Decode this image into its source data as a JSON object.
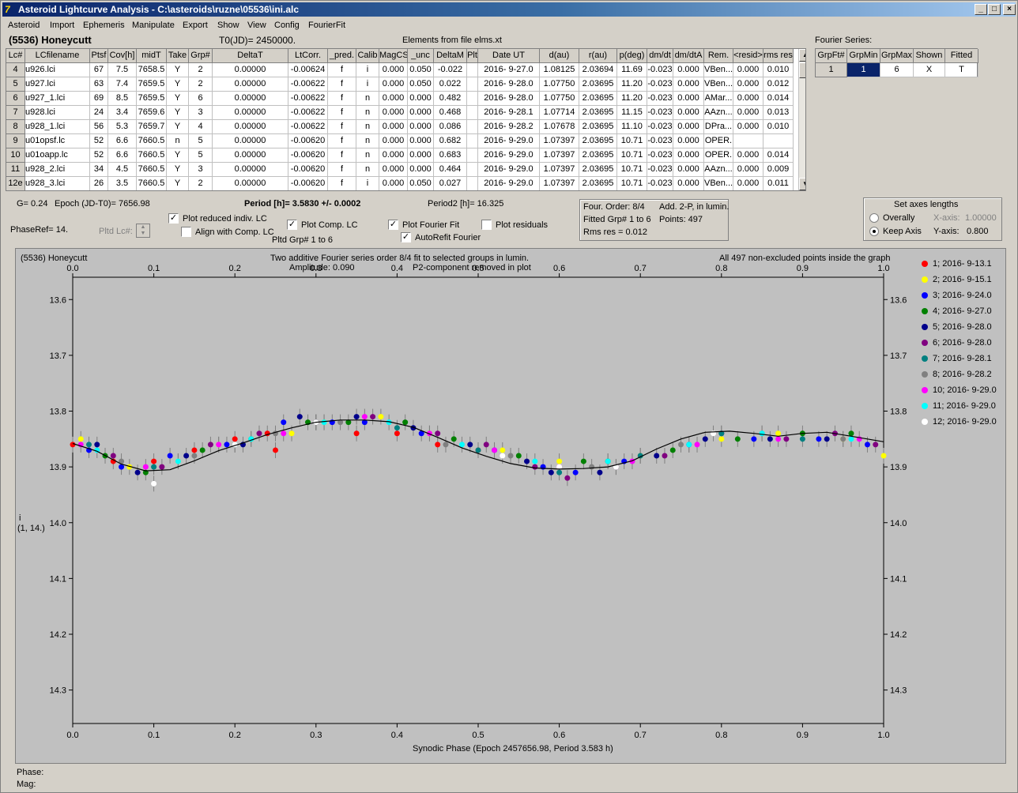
{
  "window": {
    "title": "Asteroid Lightcurve Analysis - C:\\asteroids\\ruzne\\05536\\ini.alc",
    "controls": [
      "_",
      "□",
      "×"
    ]
  },
  "menu": [
    "Asteroid",
    "Import",
    "Ephemeris",
    "Manipulate",
    "Export",
    "Show",
    "View",
    "Config",
    "FourierFit"
  ],
  "header": {
    "asteroid": "(5536) Honeycutt",
    "t0": "T0(JD)= 2450000.",
    "elements": "Elements from file elms.xt",
    "fourier_series_label": "Fourier Series:"
  },
  "lc_table": {
    "columns": [
      "Lc#",
      "LCfilename",
      "Ptsf",
      "Cov[h]",
      "midT",
      "Take",
      "Grp#",
      "DeltaT",
      "LtCorr.",
      "_pred.",
      "Calib",
      "MagCS",
      "_unc",
      "DeltaM",
      "Plt",
      "Date UT",
      "d(au)",
      "r(au)",
      "p(deg)",
      "dm/dt",
      "dm/dtA",
      "Rem.",
      "<resid>",
      "rms res"
    ],
    "rows": [
      [
        "4",
        "u926.lci",
        "67",
        "7.5",
        "7658.5",
        "Y",
        "2",
        "0.00000",
        "-0.00624",
        "f",
        "i",
        "0.000",
        "0.050",
        "-0.022",
        "",
        "2016- 9-27.0",
        "1.08125",
        "2.03694",
        "11.69",
        "-0.023",
        "0.000",
        "VBen...",
        "0.000",
        "0.010"
      ],
      [
        "5",
        "u927.lci",
        "63",
        "7.4",
        "7659.5",
        "Y",
        "2",
        "0.00000",
        "-0.00622",
        "f",
        "i",
        "0.000",
        "0.050",
        "0.022",
        "",
        "2016- 9-28.0",
        "1.07750",
        "2.03695",
        "11.20",
        "-0.023",
        "0.000",
        "VBen...",
        "0.000",
        "0.012"
      ],
      [
        "6",
        "u927_1.lci",
        "69",
        "8.5",
        "7659.5",
        "Y",
        "6",
        "0.00000",
        "-0.00622",
        "f",
        "n",
        "0.000",
        "0.000",
        "0.482",
        "",
        "2016- 9-28.0",
        "1.07750",
        "2.03695",
        "11.20",
        "-0.023",
        "0.000",
        "AMar...",
        "0.000",
        "0.014"
      ],
      [
        "7",
        "u928.lci",
        "24",
        "3.4",
        "7659.6",
        "Y",
        "3",
        "0.00000",
        "-0.00622",
        "f",
        "n",
        "0.000",
        "0.000",
        "0.468",
        "",
        "2016- 9-28.1",
        "1.07714",
        "2.03695",
        "11.15",
        "-0.023",
        "0.000",
        "AAzn...",
        "0.000",
        "0.013"
      ],
      [
        "8",
        "u928_1.lci",
        "56",
        "5.3",
        "7659.7",
        "Y",
        "4",
        "0.00000",
        "-0.00622",
        "f",
        "n",
        "0.000",
        "0.000",
        "0.086",
        "",
        "2016- 9-28.2",
        "1.07678",
        "2.03695",
        "11.10",
        "-0.023",
        "0.000",
        "DPra...",
        "0.000",
        "0.010"
      ],
      [
        "9",
        "u01opsf.lc",
        "52",
        "6.6",
        "7660.5",
        "n",
        "5",
        "0.00000",
        "-0.00620",
        "f",
        "n",
        "0.000",
        "0.000",
        "0.682",
        "",
        "2016- 9-29.0",
        "1.07397",
        "2.03695",
        "10.71",
        "-0.023",
        "0.000",
        "OPER.",
        "",
        ""
      ],
      [
        "10",
        "u01oapp.lc",
        "52",
        "6.6",
        "7660.5",
        "Y",
        "5",
        "0.00000",
        "-0.00620",
        "f",
        "n",
        "0.000",
        "0.000",
        "0.683",
        "",
        "2016- 9-29.0",
        "1.07397",
        "2.03695",
        "10.71",
        "-0.023",
        "0.000",
        "OPER.",
        "0.000",
        "0.014"
      ],
      [
        "11",
        "u928_2.lci",
        "34",
        "4.5",
        "7660.5",
        "Y",
        "3",
        "0.00000",
        "-0.00620",
        "f",
        "n",
        "0.000",
        "0.000",
        "0.464",
        "",
        "2016- 9-29.0",
        "1.07397",
        "2.03695",
        "10.71",
        "-0.023",
        "0.000",
        "AAzn...",
        "0.000",
        "0.009"
      ],
      [
        "12e",
        "u928_3.lci",
        "26",
        "3.5",
        "7660.5",
        "Y",
        "2",
        "0.00000",
        "-0.00620",
        "f",
        "i",
        "0.000",
        "0.050",
        "0.027",
        "",
        "2016- 9-29.0",
        "1.07397",
        "2.03695",
        "10.71",
        "-0.023",
        "0.000",
        "VBen...",
        "0.000",
        "0.011"
      ]
    ]
  },
  "fourier_table": {
    "columns": [
      "GrpFt#",
      "GrpMin",
      "GrpMax",
      "Shown",
      "Fitted"
    ],
    "row": [
      "1",
      "1",
      "6",
      "X",
      "T"
    ]
  },
  "info": {
    "g": "G= 0.24",
    "epoch": "Epoch (JD-T0)= 7656.98",
    "period": "Period [h]= 3.5830 +/- 0.0002",
    "period2": "Period2 [h]= 16.325",
    "phaseref": "PhaseRef= 14.",
    "pltd_lc": "Pltd Lc#:",
    "pltd_grp": "Pltd Grp#  1   to   6"
  },
  "checkboxes": {
    "plot_reduced": {
      "label": "Plot reduced indiv. LC",
      "checked": true
    },
    "align_comp": {
      "label": "Align with Comp. LC",
      "checked": false
    },
    "plot_comp": {
      "label": "Plot Comp. LC",
      "checked": true
    },
    "plot_fourier": {
      "label": "Plot Fourier Fit",
      "checked": true
    },
    "autorefit": {
      "label": "AutoRefit Fourier",
      "checked": true
    },
    "plot_residuals": {
      "label": "Plot residuals",
      "checked": false
    }
  },
  "fit_info": {
    "four_order": "Four. Order:  8/4",
    "add": "Add. 2-P, in lumin.",
    "fitted_grp": "Fitted Grp# 1 to 6",
    "points": "Points: 497",
    "rms": "Rms res    = 0.012"
  },
  "axes_lengths": {
    "title": "Set axes lengths",
    "overally": "Overally",
    "keep_axis": "Keep Axis",
    "x_axis_label": "X-axis:",
    "x_axis_value": "1.00000",
    "y_axis_label": "Y-axis:",
    "y_axis_value": "0.800",
    "selected": "Keep Axis"
  },
  "plot": {
    "top_left": "(5536) Honeycutt",
    "top_center1": "Two additive Fourier series order 8/4 fit to selected groups in lumin.",
    "top_center2a": "Amplitude: 0.090",
    "top_center2b": "P2-component removed in plot",
    "top_right": "All 497 non-excluded points inside the graph",
    "ylabel1": "i",
    "ylabel2": "(1, 14.)",
    "xlabel": "Synodic Phase (Epoch 2457656.98, Period 3.583 h)"
  },
  "chart_data": {
    "type": "scatter",
    "xlabel": "Synodic Phase (Epoch 2457656.98, Period 3.583 h)",
    "ylabel": "i",
    "xlim": [
      0.0,
      1.0
    ],
    "ylim": [
      14.36,
      13.56
    ],
    "y_inverted": true,
    "x_ticks": [
      "0.0",
      "0.1",
      "0.2",
      "0.3",
      "0.4",
      "0.5",
      "0.6",
      "0.7",
      "0.8",
      "0.9",
      "1.0"
    ],
    "y_ticks": [
      "13.6",
      "13.7",
      "13.8",
      "13.9",
      "14.0",
      "14.1",
      "14.2",
      "14.3"
    ],
    "grid": false,
    "legend_position": "right",
    "series": [
      {
        "name": "1; 2016- 9-13.1",
        "color": "#ff0000",
        "x": [
          0.0,
          0.05,
          0.1,
          0.15,
          0.2,
          0.24,
          0.25,
          0.3,
          0.35,
          0.4,
          0.45,
          0.5
        ],
        "y": [
          13.86,
          13.89,
          13.89,
          13.87,
          13.85,
          13.84,
          13.87,
          13.82,
          13.84,
          13.84,
          13.86,
          13.87
        ]
      },
      {
        "name": "2; 2016- 9-15.1",
        "color": "#ffff00",
        "x": [
          0.01,
          0.07,
          0.13,
          0.18,
          0.27,
          0.31,
          0.38,
          0.44,
          0.53,
          0.6,
          0.7,
          0.8,
          0.87,
          0.95,
          1.0
        ],
        "y": [
          13.85,
          13.9,
          13.89,
          13.86,
          13.84,
          13.82,
          13.81,
          13.84,
          13.87,
          13.89,
          13.88,
          13.85,
          13.84,
          13.85,
          13.88
        ]
      },
      {
        "name": "3; 2016- 9-24.0",
        "color": "#0000ff",
        "x": [
          0.02,
          0.06,
          0.12,
          0.19,
          0.26,
          0.32,
          0.36,
          0.43,
          0.52,
          0.58,
          0.62,
          0.68,
          0.76,
          0.84,
          0.92,
          0.98
        ],
        "y": [
          13.87,
          13.9,
          13.88,
          13.86,
          13.82,
          13.82,
          13.82,
          13.84,
          13.87,
          13.9,
          13.91,
          13.89,
          13.86,
          13.85,
          13.85,
          13.86
        ]
      },
      {
        "name": "4; 2016- 9-27.0",
        "color": "#008000",
        "x": [
          0.04,
          0.09,
          0.16,
          0.22,
          0.29,
          0.34,
          0.41,
          0.47,
          0.55,
          0.63,
          0.66,
          0.74,
          0.82,
          0.9,
          0.96
        ],
        "y": [
          13.88,
          13.91,
          13.87,
          13.85,
          13.82,
          13.82,
          13.82,
          13.85,
          13.88,
          13.89,
          13.89,
          13.87,
          13.85,
          13.84,
          13.84
        ]
      },
      {
        "name": "5; 2016- 9-28.0",
        "color": "#00008b",
        "x": [
          0.03,
          0.08,
          0.14,
          0.21,
          0.28,
          0.35,
          0.42,
          0.49,
          0.56,
          0.59,
          0.65,
          0.72,
          0.78,
          0.86,
          0.93
        ],
        "y": [
          13.86,
          13.91,
          13.88,
          13.86,
          13.81,
          13.81,
          13.83,
          13.86,
          13.89,
          13.91,
          13.91,
          13.88,
          13.85,
          13.85,
          13.85
        ]
      },
      {
        "name": "6; 2016- 9-28.0",
        "color": "#800080",
        "x": [
          0.05,
          0.11,
          0.17,
          0.23,
          0.3,
          0.37,
          0.45,
          0.51,
          0.57,
          0.61,
          0.67,
          0.73,
          0.8,
          0.88,
          0.94,
          0.99
        ],
        "y": [
          13.88,
          13.9,
          13.86,
          13.84,
          13.82,
          13.81,
          13.84,
          13.86,
          13.9,
          13.92,
          13.9,
          13.88,
          13.84,
          13.85,
          13.84,
          13.86
        ]
      },
      {
        "name": "7; 2016- 9-28.1",
        "color": "#008080",
        "x": [
          0.02,
          0.1,
          0.2,
          0.3,
          0.4,
          0.5,
          0.6,
          0.7,
          0.8,
          0.9
        ],
        "y": [
          13.86,
          13.9,
          13.86,
          13.82,
          13.83,
          13.87,
          13.91,
          13.88,
          13.84,
          13.85
        ]
      },
      {
        "name": "8; 2016- 9-28.2",
        "color": "#808080",
        "x": [
          0.06,
          0.15,
          0.25,
          0.33,
          0.46,
          0.54,
          0.64,
          0.75,
          0.85,
          0.95
        ],
        "y": [
          13.89,
          13.88,
          13.84,
          13.82,
          13.86,
          13.88,
          13.9,
          13.86,
          13.84,
          13.85
        ]
      },
      {
        "name": "10; 2016- 9-29.0",
        "color": "#ff00ff",
        "x": [
          0.01,
          0.09,
          0.18,
          0.26,
          0.36,
          0.44,
          0.52,
          0.6,
          0.69,
          0.77,
          0.87,
          0.97
        ],
        "y": [
          13.86,
          13.9,
          13.86,
          13.84,
          13.81,
          13.84,
          13.87,
          13.9,
          13.89,
          13.86,
          13.85,
          13.85
        ]
      },
      {
        "name": "11; 2016- 9-29.0",
        "color": "#00ffff",
        "x": [
          0.03,
          0.13,
          0.22,
          0.31,
          0.39,
          0.48,
          0.57,
          0.66,
          0.76,
          0.85,
          0.96
        ],
        "y": [
          13.87,
          13.89,
          13.85,
          13.82,
          13.82,
          13.86,
          13.89,
          13.89,
          13.86,
          13.84,
          13.85
        ]
      },
      {
        "name": "12; 2016- 9-29.0",
        "color": "#ffffff",
        "x": [
          0.1,
          0.2,
          0.3,
          0.53,
          0.6,
          0.67,
          0.79
        ],
        "y": [
          13.93,
          13.86,
          13.82,
          13.88,
          13.9,
          13.9,
          13.84
        ]
      }
    ],
    "fit_curve": {
      "x": [
        0.0,
        0.03,
        0.06,
        0.09,
        0.12,
        0.15,
        0.18,
        0.21,
        0.24,
        0.27,
        0.3,
        0.33,
        0.36,
        0.39,
        0.42,
        0.45,
        0.48,
        0.51,
        0.54,
        0.57,
        0.6,
        0.63,
        0.66,
        0.69,
        0.72,
        0.75,
        0.78,
        0.81,
        0.84,
        0.87,
        0.9,
        0.93,
        0.96,
        1.0
      ],
      "y": [
        13.858,
        13.872,
        13.895,
        13.907,
        13.905,
        13.889,
        13.871,
        13.857,
        13.842,
        13.83,
        13.82,
        13.816,
        13.816,
        13.819,
        13.829,
        13.847,
        13.866,
        13.881,
        13.894,
        13.902,
        13.904,
        13.903,
        13.9,
        13.889,
        13.868,
        13.85,
        13.838,
        13.836,
        13.84,
        13.845,
        13.84,
        13.838,
        13.845,
        13.855
      ]
    }
  }
}
